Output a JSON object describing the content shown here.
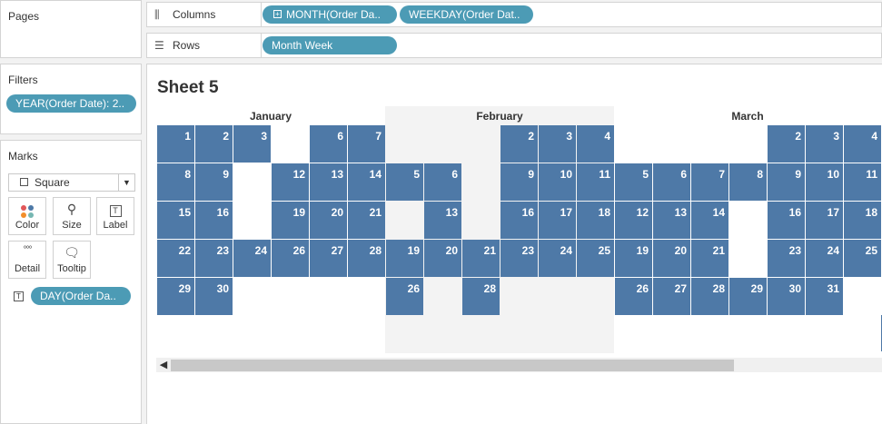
{
  "left": {
    "pages_title": "Pages",
    "filters_title": "Filters",
    "filter_pill": "YEAR(Order Date): 2..",
    "marks_title": "Marks",
    "mark_type": "Square",
    "buttons": {
      "color": "Color",
      "size": "Size",
      "label": "Label",
      "detail": "Detail",
      "tooltip": "Tooltip"
    },
    "label_pill": "DAY(Order Da.."
  },
  "shelves": {
    "columns_label": "Columns",
    "columns_pills": [
      "MONTH(Order Da..",
      "WEEKDAY(Order Dat.."
    ],
    "rows_label": "Rows",
    "rows_pills": [
      "Month Week"
    ]
  },
  "sheet": {
    "title": "Sheet 5",
    "months": [
      "January",
      "February",
      "March"
    ]
  },
  "colors": {
    "mark": "#4e79a7",
    "pill": "#4c9bb5",
    "band": "#f3f3f3"
  },
  "calendar": [
    {
      "month": "January",
      "weekday": 0,
      "week": 0,
      "day": "1"
    },
    {
      "month": "January",
      "weekday": 1,
      "week": 0,
      "day": "2"
    },
    {
      "month": "January",
      "weekday": 2,
      "week": 0,
      "day": "3"
    },
    {
      "month": "January",
      "weekday": 4,
      "week": 0,
      "day": "6"
    },
    {
      "month": "January",
      "weekday": 5,
      "week": 0,
      "day": "7"
    },
    {
      "month": "January",
      "weekday": 0,
      "week": 1,
      "day": "8"
    },
    {
      "month": "January",
      "weekday": 1,
      "week": 1,
      "day": "9"
    },
    {
      "month": "January",
      "weekday": 3,
      "week": 1,
      "day": "12"
    },
    {
      "month": "January",
      "weekday": 4,
      "week": 1,
      "day": "13"
    },
    {
      "month": "January",
      "weekday": 5,
      "week": 1,
      "day": "14"
    },
    {
      "month": "January",
      "weekday": 0,
      "week": 2,
      "day": "15"
    },
    {
      "month": "January",
      "weekday": 1,
      "week": 2,
      "day": "16"
    },
    {
      "month": "January",
      "weekday": 3,
      "week": 2,
      "day": "19"
    },
    {
      "month": "January",
      "weekday": 4,
      "week": 2,
      "day": "20"
    },
    {
      "month": "January",
      "weekday": 5,
      "week": 2,
      "day": "21"
    },
    {
      "month": "January",
      "weekday": 0,
      "week": 3,
      "day": "22"
    },
    {
      "month": "January",
      "weekday": 1,
      "week": 3,
      "day": "23"
    },
    {
      "month": "January",
      "weekday": 2,
      "week": 3,
      "day": "24"
    },
    {
      "month": "January",
      "weekday": 3,
      "week": 3,
      "day": "26"
    },
    {
      "month": "January",
      "weekday": 4,
      "week": 3,
      "day": "27"
    },
    {
      "month": "January",
      "weekday": 5,
      "week": 3,
      "day": "28"
    },
    {
      "month": "January",
      "weekday": 0,
      "week": 4,
      "day": "29"
    },
    {
      "month": "January",
      "weekday": 1,
      "week": 4,
      "day": "30"
    },
    {
      "month": "February",
      "weekday": 6,
      "week": 1,
      "day": "5"
    },
    {
      "month": "February",
      "weekday": 7,
      "week": 1,
      "day": "6"
    },
    {
      "month": "February",
      "weekday": 7,
      "week": 2,
      "day": "13"
    },
    {
      "month": "February",
      "weekday": 6,
      "week": 3,
      "day": "19"
    },
    {
      "month": "February",
      "weekday": 7,
      "week": 3,
      "day": "20"
    },
    {
      "month": "February",
      "weekday": 8,
      "week": 3,
      "day": "21"
    },
    {
      "month": "February",
      "weekday": 6,
      "week": 4,
      "day": "26"
    },
    {
      "month": "February",
      "weekday": 8,
      "week": 4,
      "day": "28"
    },
    {
      "month": "February",
      "weekday": 9,
      "week": 0,
      "day": "2"
    },
    {
      "month": "February",
      "weekday": 10,
      "week": 0,
      "day": "3"
    },
    {
      "month": "February",
      "weekday": 11,
      "week": 0,
      "day": "4"
    },
    {
      "month": "February",
      "weekday": 9,
      "week": 1,
      "day": "9"
    },
    {
      "month": "February",
      "weekday": 10,
      "week": 1,
      "day": "10"
    },
    {
      "month": "February",
      "weekday": 11,
      "week": 1,
      "day": "11"
    },
    {
      "month": "February",
      "weekday": 9,
      "week": 2,
      "day": "16"
    },
    {
      "month": "February",
      "weekday": 10,
      "week": 2,
      "day": "17"
    },
    {
      "month": "February",
      "weekday": 11,
      "week": 2,
      "day": "18"
    },
    {
      "month": "February",
      "weekday": 9,
      "week": 3,
      "day": "23"
    },
    {
      "month": "February",
      "weekday": 10,
      "week": 3,
      "day": "24"
    },
    {
      "month": "February",
      "weekday": 11,
      "week": 3,
      "day": "25"
    },
    {
      "month": "March",
      "weekday": 12,
      "week": 1,
      "day": "5"
    },
    {
      "month": "March",
      "weekday": 13,
      "week": 1,
      "day": "6"
    },
    {
      "month": "March",
      "weekday": 14,
      "week": 1,
      "day": "7"
    },
    {
      "month": "March",
      "weekday": 15,
      "week": 1,
      "day": "8"
    },
    {
      "month": "March",
      "weekday": 12,
      "week": 2,
      "day": "12"
    },
    {
      "month": "March",
      "weekday": 13,
      "week": 2,
      "day": "13"
    },
    {
      "month": "March",
      "weekday": 14,
      "week": 2,
      "day": "14"
    },
    {
      "month": "March",
      "weekday": 12,
      "week": 3,
      "day": "19"
    },
    {
      "month": "March",
      "weekday": 13,
      "week": 3,
      "day": "20"
    },
    {
      "month": "March",
      "weekday": 14,
      "week": 3,
      "day": "21"
    },
    {
      "month": "March",
      "weekday": 12,
      "week": 4,
      "day": "26"
    },
    {
      "month": "March",
      "weekday": 13,
      "week": 4,
      "day": "27"
    },
    {
      "month": "March",
      "weekday": 14,
      "week": 4,
      "day": "28"
    },
    {
      "month": "March",
      "weekday": 15,
      "week": 4,
      "day": "29"
    },
    {
      "month": "March",
      "weekday": 16,
      "week": 0,
      "day": "2"
    },
    {
      "month": "March",
      "weekday": 17,
      "week": 0,
      "day": "3"
    },
    {
      "month": "March",
      "weekday": 18,
      "week": 0,
      "day": "4"
    },
    {
      "month": "March",
      "weekday": 16,
      "week": 1,
      "day": "9"
    },
    {
      "month": "March",
      "weekday": 17,
      "week": 1,
      "day": "10"
    },
    {
      "month": "March",
      "weekday": 18,
      "week": 1,
      "day": "11"
    },
    {
      "month": "March",
      "weekday": 16,
      "week": 2,
      "day": "16"
    },
    {
      "month": "March",
      "weekday": 17,
      "week": 2,
      "day": "17"
    },
    {
      "month": "March",
      "weekday": 18,
      "week": 2,
      "day": "18"
    },
    {
      "month": "March",
      "weekday": 16,
      "week": 3,
      "day": "23"
    },
    {
      "month": "March",
      "weekday": 17,
      "week": 3,
      "day": "24"
    },
    {
      "month": "March",
      "weekday": 18,
      "week": 3,
      "day": "25"
    },
    {
      "month": "March",
      "weekday": 16,
      "week": 4,
      "day": "30"
    },
    {
      "month": "March",
      "weekday": 17,
      "week": 4,
      "day": "31"
    }
  ]
}
